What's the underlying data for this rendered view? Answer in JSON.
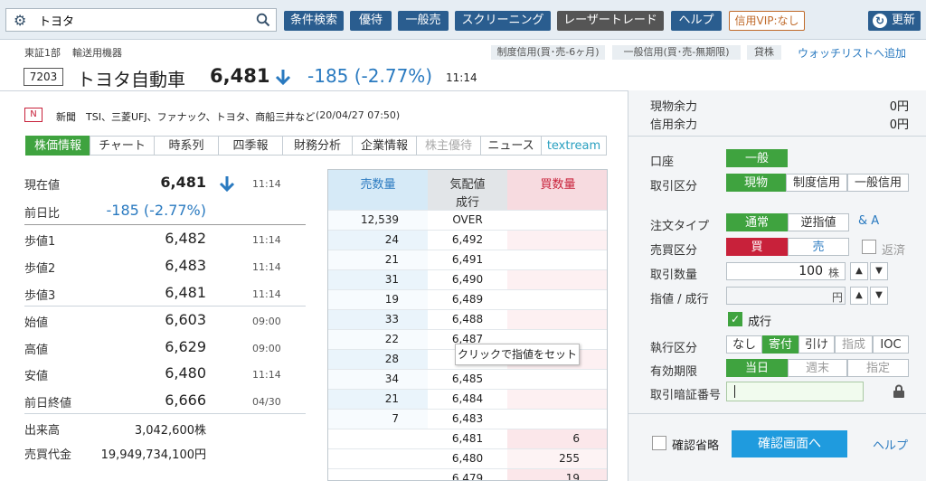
{
  "header": {
    "search": {
      "value": "トヨタ",
      "placeholder": ""
    },
    "nav": [
      "条件検索",
      "優待",
      "一般売",
      "スクリーニング",
      "レーザートレード",
      "ヘルプ",
      "信用VIP:なし"
    ],
    "update": "更新"
  },
  "stock": {
    "market": "東証1部",
    "industry": "輸送用機器",
    "code": "7203",
    "name": "トヨタ自動車",
    "price": "6,481",
    "change": "-185 (-2.77%)",
    "time": "11:14",
    "tags": [
      "制度信用(買･売-6ヶ月)",
      "一般信用(買･売-無期限)",
      "貸株"
    ],
    "watchlist": "ウォッチリストへ追加"
  },
  "news": {
    "badge": "N",
    "label": "新聞",
    "text": "TSI、三菱UFJ、ファナック、トヨタ、商船三井など",
    "date": "(20/04/27 07:50)"
  },
  "tabs": [
    "株価情報",
    "チャート",
    "時系列",
    "四季報",
    "財務分析",
    "企業情報",
    "株主優待",
    "ニュース",
    "textream"
  ],
  "quote": {
    "current": {
      "label": "現在値",
      "value": "6,481",
      "time": "11:14"
    },
    "change": {
      "label": "前日比",
      "value": "-185 (-2.77%)"
    },
    "rows": [
      {
        "label": "歩値1",
        "value": "6,482",
        "time": "11:14"
      },
      {
        "label": "歩値2",
        "value": "6,483",
        "time": "11:14"
      },
      {
        "label": "歩値3",
        "value": "6,481",
        "time": "11:14"
      },
      {
        "label": "始値",
        "value": "6,603",
        "time": "09:00"
      },
      {
        "label": "高値",
        "value": "6,629",
        "time": "09:00"
      },
      {
        "label": "安値",
        "value": "6,480",
        "time": "11:14"
      },
      {
        "label": "前日終値",
        "value": "6,666",
        "time": "04/30"
      }
    ],
    "volume": {
      "label": "出来高",
      "value": "3,042,600株"
    },
    "turnover": {
      "label": "売買代金",
      "value": "19,949,734,100円"
    }
  },
  "board": {
    "headers": {
      "sell": "売数量",
      "price": "気配値",
      "market": "成行",
      "buy": "買数量"
    },
    "rows": [
      {
        "sell": "12,539",
        "price": "OVER",
        "buy": ""
      },
      {
        "sell": "24",
        "price": "6,492",
        "buy": ""
      },
      {
        "sell": "21",
        "price": "6,491",
        "buy": ""
      },
      {
        "sell": "31",
        "price": "6,490",
        "buy": ""
      },
      {
        "sell": "19",
        "price": "6,489",
        "buy": ""
      },
      {
        "sell": "33",
        "price": "6,488",
        "buy": ""
      },
      {
        "sell": "22",
        "price": "6,487",
        "buy": ""
      },
      {
        "sell": "28",
        "price": "",
        "buy": ""
      },
      {
        "sell": "34",
        "price": "6,485",
        "buy": ""
      },
      {
        "sell": "21",
        "price": "6,484",
        "buy": ""
      },
      {
        "sell": "7",
        "price": "6,483",
        "buy": ""
      },
      {
        "sell": "",
        "price": "6,481",
        "buy": "6"
      },
      {
        "sell": "",
        "price": "6,480",
        "buy": "255"
      },
      {
        "sell": "",
        "price": "6,479",
        "buy": "19"
      }
    ],
    "tooltip": "クリックで指値をセット"
  },
  "order": {
    "cash_label": "現物余力",
    "cash_value": "0円",
    "margin_label": "信用余力",
    "margin_value": "0円",
    "account_label": "口座",
    "account_value": "一般",
    "trade_label": "取引区分",
    "trade_options": [
      "現物",
      "制度信用",
      "一般信用"
    ],
    "type_label": "注文タイプ",
    "type_options": [
      "通常",
      "逆指値"
    ],
    "ifd": "& A",
    "side_label": "売買区分",
    "side_buy": "買",
    "side_sell": "売",
    "return_label": "返済",
    "qty_label": "取引数量",
    "qty_value": "100",
    "qty_unit": "株",
    "price_label": "指値 / 成行",
    "price_unit": "円",
    "market_label": "成行",
    "exec_label": "執行区分",
    "exec_options": [
      "なし",
      "寄付",
      "引け",
      "指成",
      "IOC"
    ],
    "expiry_label": "有効期限",
    "expiry_options": [
      "当日",
      "週末",
      "指定"
    ],
    "pin_label": "取引暗証番号",
    "confirm_skip": "確認省略",
    "confirm_button": "確認画面へ",
    "help": "ヘルプ"
  }
}
